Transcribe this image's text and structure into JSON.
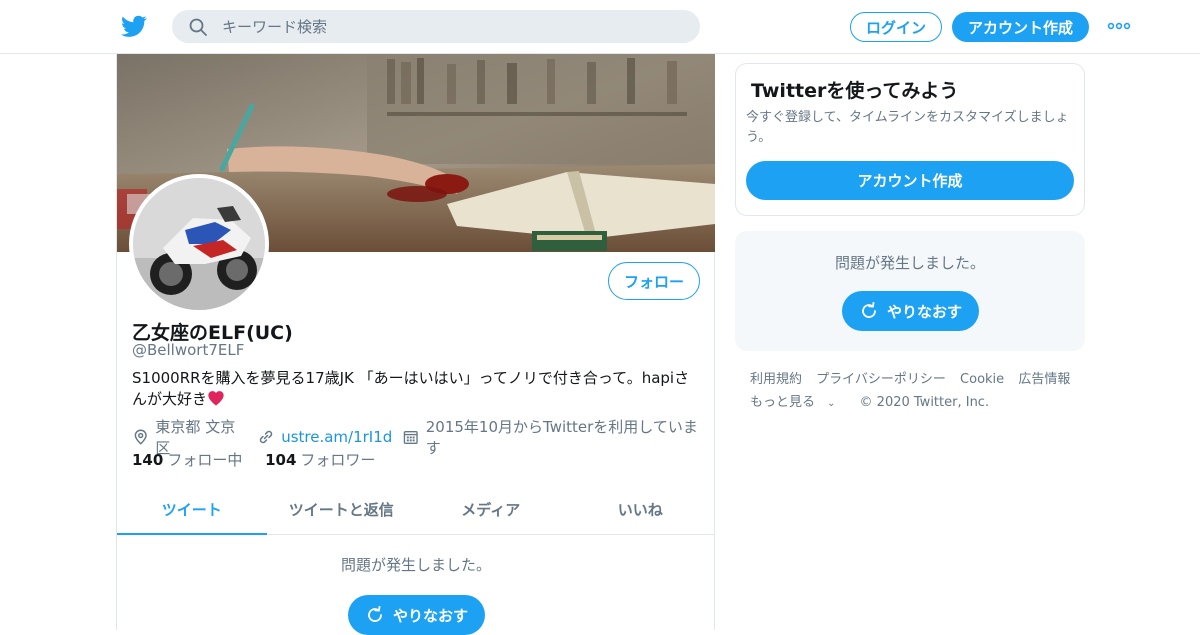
{
  "header": {
    "search_placeholder": "キーワード検索",
    "login_label": "ログイン",
    "signup_label": "アカウント作成"
  },
  "profile": {
    "name": "乙女座のELF(UC)",
    "handle": "@Bellwort7ELF",
    "follow_label": "フォロー",
    "bio": "S1000RRを購入を夢見る17歳JK 「あーはいはい」ってノリで付き合って。hapiさんが大好き",
    "location": "東京都 文京区",
    "url": "ustre.am/1rI1d",
    "joined": "2015年10月からTwitterを利用しています",
    "following_count": "140",
    "following_label": "フォロー中",
    "followers_count": "104",
    "followers_label": "フォロワー"
  },
  "tabs": [
    {
      "label": "ツイート",
      "active": true
    },
    {
      "label": "ツイートと返信",
      "active": false
    },
    {
      "label": "メディア",
      "active": false
    },
    {
      "label": "いいね",
      "active": false
    }
  ],
  "timeline": {
    "error_message": "問題が発生しました。",
    "retry_label": "やりなおす"
  },
  "signup_card": {
    "title": "Twitterを使ってみよう",
    "description": "今すぐ登録して、タイムラインをカスタマイズしましょう。",
    "button_label": "アカウント作成"
  },
  "trends_card": {
    "error_message": "問題が発生しました。",
    "retry_label": "やりなおす"
  },
  "footer": {
    "links": [
      "利用規約",
      "プライバシーポリシー",
      "Cookie",
      "広告情報"
    ],
    "more_label": "もっと見る",
    "copyright": "© 2020 Twitter, Inc."
  },
  "colors": {
    "accent": "#1da1f2",
    "secondary_text": "#657786",
    "border": "#e1e8ed",
    "heart": "#e0245e"
  }
}
